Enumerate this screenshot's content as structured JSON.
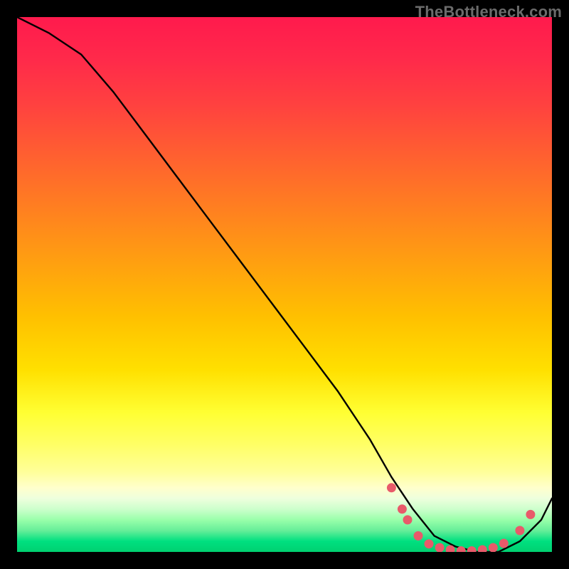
{
  "watermark": "TheBottleneck.com",
  "chart_data": {
    "type": "line",
    "title": "",
    "xlabel": "",
    "ylabel": "",
    "xlim": [
      0,
      100
    ],
    "ylim": [
      0,
      100
    ],
    "series": [
      {
        "name": "curve",
        "x": [
          0,
          6,
          12,
          18,
          24,
          30,
          36,
          42,
          48,
          54,
          60,
          66,
          70,
          74,
          78,
          82,
          86,
          90,
          94,
          98,
          100
        ],
        "y": [
          100,
          97,
          93,
          86,
          78,
          70,
          62,
          54,
          46,
          38,
          30,
          21,
          14,
          8,
          3,
          1,
          0,
          0,
          2,
          6,
          10
        ]
      }
    ],
    "markers": {
      "name": "red-dots",
      "color": "#e85a6a",
      "points": [
        {
          "x": 70,
          "y": 12
        },
        {
          "x": 72,
          "y": 8
        },
        {
          "x": 73,
          "y": 6
        },
        {
          "x": 75,
          "y": 3
        },
        {
          "x": 77,
          "y": 1.5
        },
        {
          "x": 79,
          "y": 0.8
        },
        {
          "x": 81,
          "y": 0.4
        },
        {
          "x": 83,
          "y": 0.2
        },
        {
          "x": 85,
          "y": 0.2
        },
        {
          "x": 87,
          "y": 0.4
        },
        {
          "x": 89,
          "y": 0.8
        },
        {
          "x": 91,
          "y": 1.6
        },
        {
          "x": 94,
          "y": 4
        },
        {
          "x": 96,
          "y": 7
        }
      ]
    }
  }
}
